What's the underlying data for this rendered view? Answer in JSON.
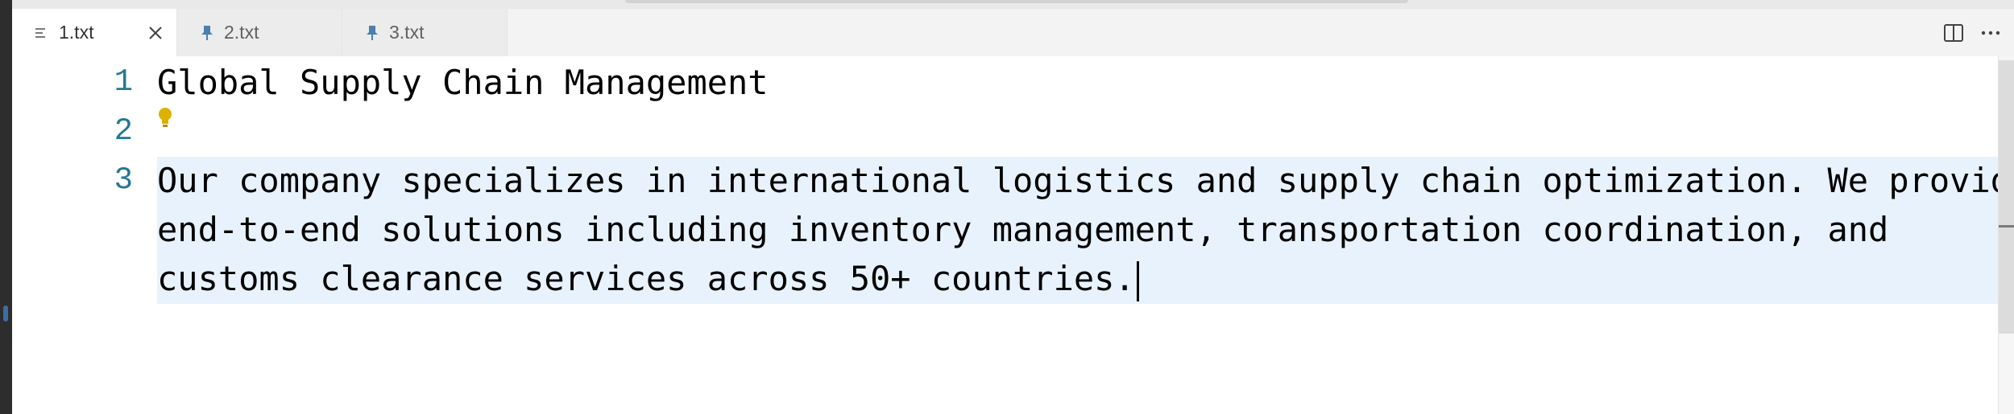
{
  "tabs": [
    {
      "label": "1.txt",
      "icon": "text-file-icon",
      "active": true
    },
    {
      "label": "2.txt",
      "icon": "pinned-file-icon",
      "active": false
    },
    {
      "label": "3.txt",
      "icon": "pinned-file-icon",
      "active": false
    }
  ],
  "editor": {
    "line_numbers": [
      "1",
      "2",
      "3"
    ],
    "lines": [
      "Global Supply Chain Management",
      "",
      "Our company specializes in international logistics and supply chain optimization. We provide",
      "end-to-end solutions including inventory management, transportation coordination, and",
      "customs clearance services across 50+ countries."
    ]
  },
  "colors": {
    "line_number": "#237893",
    "selection": "#e8f2fc",
    "lightbulb": "#ddb100",
    "pin_icon": "#4a7fb0"
  },
  "actions": {
    "split_editor": "split-editor-icon",
    "more": "more-actions-icon"
  }
}
